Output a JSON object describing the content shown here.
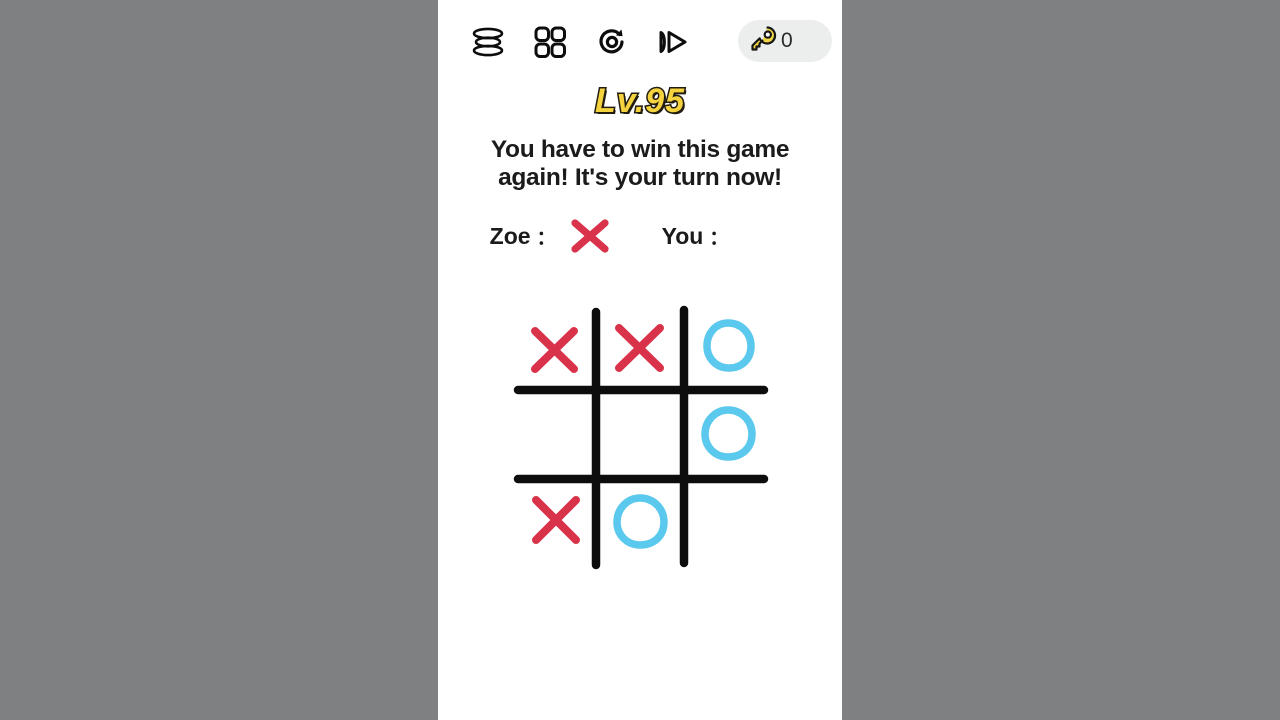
{
  "app": {
    "background_color": "#7f8082",
    "panel_color": "#ffffff"
  },
  "toolbar": {
    "menu_label": "menu-icon",
    "levels_label": "levels-grid-icon",
    "restart_label": "restart-icon",
    "skip_label": "fast-forward-icon",
    "key_count": "0",
    "key_pill_color": "#eceded",
    "key_color": "#f0d547"
  },
  "level": {
    "title": "Lv.95",
    "title_color": "#f5d33f",
    "title_outline_color": "#221c10"
  },
  "prompt": {
    "line1": "You have to win this game",
    "line2": "again! It's your turn now!",
    "full_text": "You have to win this game again! It's your turn now!"
  },
  "players": {
    "opponent": {
      "name": "Zoe",
      "colon": "：",
      "mark": "X",
      "mark_color": "#d8334a"
    },
    "user": {
      "name": "You",
      "colon": "：",
      "mark": "",
      "mark_color": "#5bc8ee"
    }
  },
  "colors": {
    "x_mark": "#d8334a",
    "o_mark": "#5bc8ee",
    "grid_line": "#0d0d0d",
    "text": "#1b1b1b"
  },
  "chart_data": {
    "type": "table",
    "title": "Tic Tac Toe Board",
    "rows": 3,
    "cols": 3,
    "cells": [
      [
        "X",
        "X",
        "O"
      ],
      [
        "",
        "",
        "O"
      ],
      [
        "X",
        "O",
        ""
      ]
    ],
    "legend": {
      "X": "#d8334a",
      "O": "#5bc8ee"
    }
  }
}
